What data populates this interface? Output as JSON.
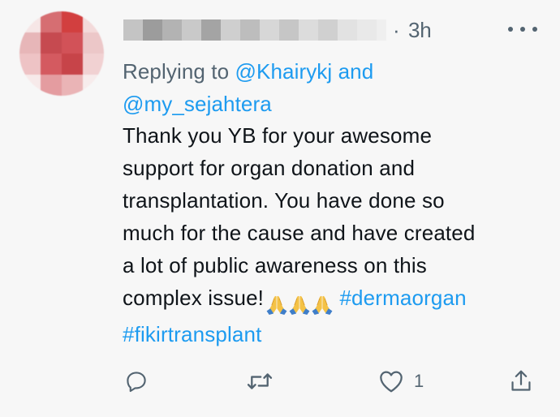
{
  "tweet": {
    "time": "3h",
    "separator": "·",
    "replying_prefix": "Replying to",
    "reply_handle_1": "@Khairykj",
    "reply_joiner": "and",
    "reply_handle_2": "@my_sejahtera",
    "text_line_1": "Thank you YB for your awesome",
    "text_line_2": "support for organ donation and",
    "text_line_3": "transplantation. You have done so",
    "text_line_4": "much for the cause and have created",
    "text_line_5": "a lot of public awareness on this",
    "text_line_6": "complex issue!",
    "hashtag_1": "#dermaorgan",
    "hashtag_2": "#fikirtransplant",
    "emojis": [
      "folded-hands-emoji",
      "folded-hands-emoji",
      "folded-hands-emoji"
    ]
  },
  "actions": {
    "reply_icon": "reply-icon",
    "retweet_icon": "retweet-icon",
    "like_icon": "heart-icon",
    "like_count": "1",
    "share_icon": "share-icon"
  },
  "colors": {
    "background": "#f7f7f7",
    "text": "#0f1419",
    "muted": "#536471",
    "accent": "#1d9bf0"
  }
}
